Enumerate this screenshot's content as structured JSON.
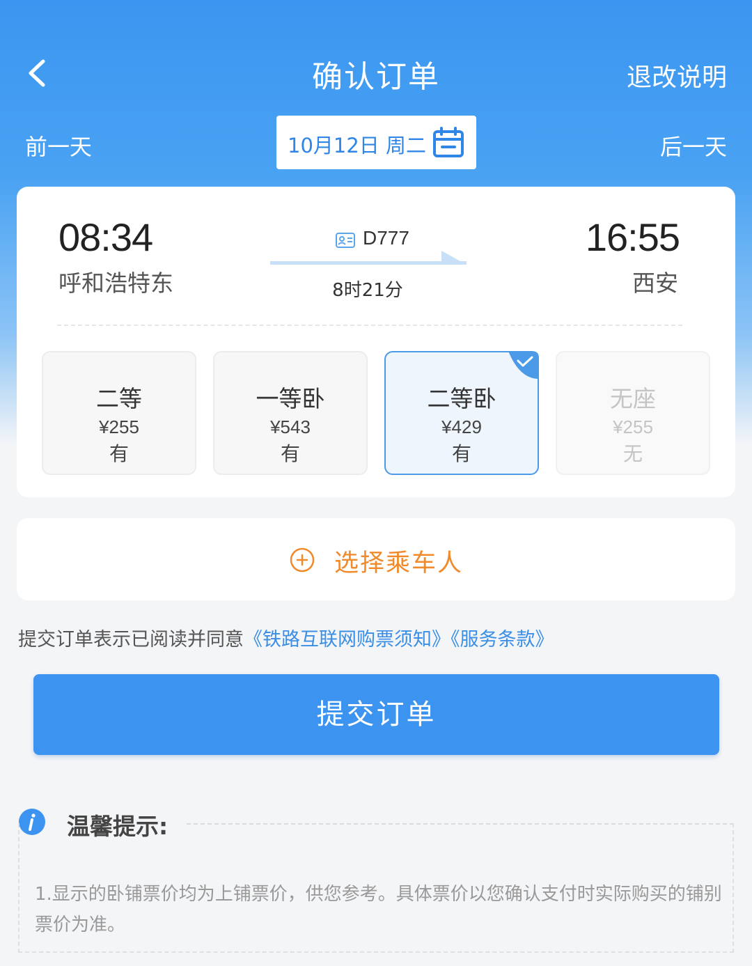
{
  "header": {
    "title": "确认订单",
    "refund_link": "退改说明"
  },
  "datebar": {
    "prev": "前一天",
    "date": "10月12日 周二",
    "next": "后一天"
  },
  "trip": {
    "departure_time": "08:34",
    "departure_station": "呼和浩特东",
    "train_no": "D777",
    "duration": "8时21分",
    "arrival_time": "16:55",
    "arrival_station": "西安"
  },
  "seats": [
    {
      "name": "二等",
      "price": "¥255",
      "availability": "有",
      "selected": false,
      "disabled": false
    },
    {
      "name": "一等卧",
      "price": "¥543",
      "availability": "有",
      "selected": false,
      "disabled": false
    },
    {
      "name": "二等卧",
      "price": "¥429",
      "availability": "有",
      "selected": true,
      "disabled": false
    },
    {
      "name": "无座",
      "price": "¥255",
      "availability": "无",
      "selected": false,
      "disabled": true
    }
  ],
  "passenger": {
    "add_label": "选择乘车人"
  },
  "agreement": {
    "prefix": "提交订单表示已阅读并同意",
    "link1": "《铁路互联网购票须知》",
    "link2": "《服务条款》"
  },
  "submit_label": "提交订单",
  "tips": {
    "title": "温馨提示:",
    "text": "1.显示的卧铺票价均为上铺票价，供您参考。具体票价以您确认支付时实际购买的铺别票价为准。"
  },
  "colors": {
    "primary": "#3d94f0",
    "accent_orange": "#f08a2a",
    "link_blue": "#3a8ee6"
  }
}
